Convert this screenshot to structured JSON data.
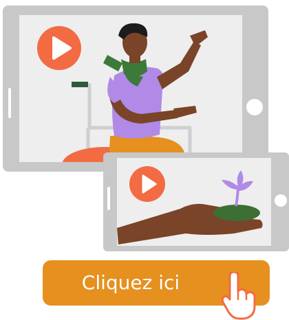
{
  "cta": {
    "label": "Cliquez ici"
  },
  "icons": {
    "large_play": "play-icon",
    "small_play": "play-icon",
    "cursor": "hand-pointer-icon"
  },
  "colors": {
    "device_frame": "#c8c8c8",
    "screen": "#eeeeee",
    "play_button": "#f26b43",
    "cta_button": "#e5901f",
    "cta_text": "#ffffff"
  }
}
